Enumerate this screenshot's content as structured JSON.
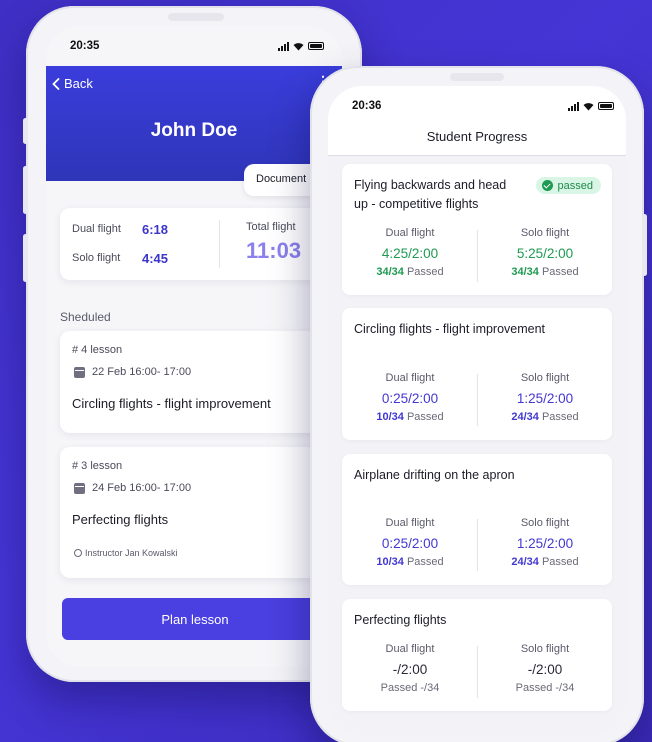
{
  "left_phone": {
    "status_time": "20:35",
    "back_label": "Back",
    "student_name": "John Doe",
    "documents_tab": "Document",
    "hours": {
      "dual_label": "Dual flight",
      "dual_value": "6:18",
      "solo_label": "Solo flight",
      "solo_value": "4:45",
      "total_label": "Total flight",
      "total_value": "11:03"
    },
    "scheduled_label": "Sheduled",
    "lessons": [
      {
        "number": "# 4 lesson",
        "date": "22 Feb 16:00- 17:00",
        "title": "Circling flights - flight improvement",
        "instructor": ""
      },
      {
        "number": "# 3 lesson",
        "date": "24 Feb 16:00- 17:00",
        "title": "Perfecting flights",
        "instructor": "Instructor Jan Kowalski"
      }
    ],
    "plan_button": "Plan lesson"
  },
  "right_phone": {
    "status_time": "20:36",
    "page_title": "Student Progress",
    "passed_badge": "passed",
    "progress": [
      {
        "title_line1": "Flying backwards and head",
        "title_line2": "up - competitive flights",
        "status": "passed",
        "dual": {
          "label": "Dual flight",
          "value": "4:25/2:00",
          "count": "34/34",
          "suffix": "Passed"
        },
        "solo": {
          "label": "Solo flight",
          "value": "5:25/2:00",
          "count": "34/34",
          "suffix": "Passed"
        }
      },
      {
        "title_line1": "Circling flights - flight improvement",
        "title_line2": "",
        "status": "",
        "dual": {
          "label": "Dual flight",
          "value": "0:25/2:00",
          "count": "10/34",
          "suffix": "Passed"
        },
        "solo": {
          "label": "Solo flight",
          "value": "1:25/2:00",
          "count": "24/34",
          "suffix": "Passed"
        }
      },
      {
        "title_line1": "Airplane drifting on the apron",
        "title_line2": "",
        "status": "",
        "dual": {
          "label": "Dual flight",
          "value": "0:25/2:00",
          "count": "10/34",
          "suffix": "Passed"
        },
        "solo": {
          "label": "Solo flight",
          "value": "1:25/2:00",
          "count": "24/34",
          "suffix": "Passed"
        }
      },
      {
        "title_line1": "Perfecting flights",
        "title_line2": "",
        "status": "",
        "dual": {
          "label": "Dual flight",
          "value": "-/2:00",
          "count": "-/34",
          "suffix": "Passed"
        },
        "solo": {
          "label": "Solo flight",
          "value": "-/2:00",
          "count": "-/34",
          "suffix": "Passed"
        }
      }
    ]
  },
  "colors": {
    "accent": "#4a3fe0",
    "passed_green": "#1f9a52",
    "progress_blue": "#4238d0",
    "total_light": "#8b80ec"
  }
}
